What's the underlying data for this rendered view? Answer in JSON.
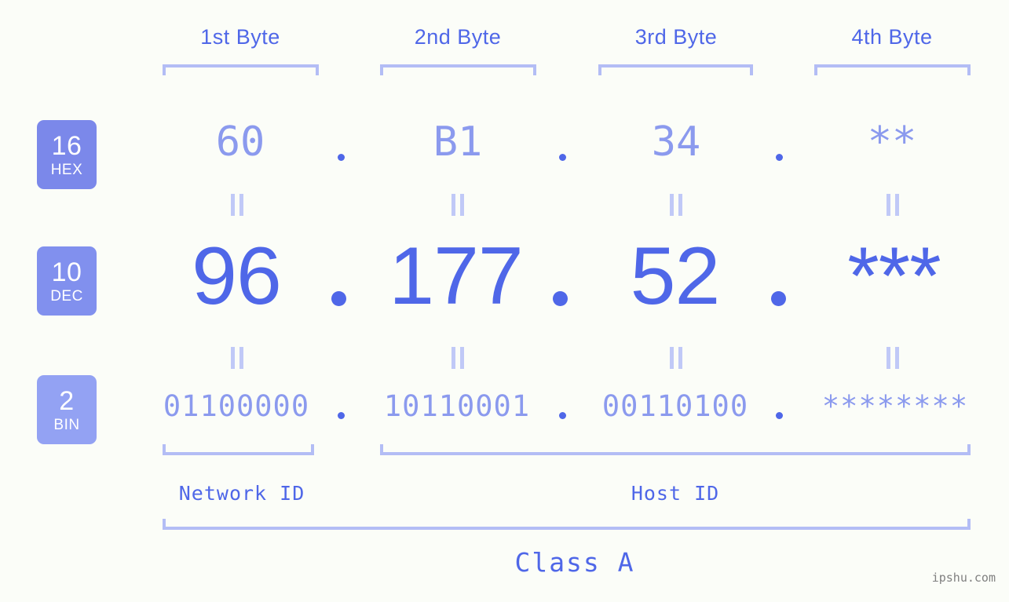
{
  "background_color": "#fbfdf8",
  "accent_color": "#4f67e8",
  "muted_accent_color": "#8b9aee",
  "bracket_color": "#b3bdf5",
  "byte_headers": [
    {
      "label": "1st Byte"
    },
    {
      "label": "2nd Byte"
    },
    {
      "label": "3rd Byte"
    },
    {
      "label": "4th Byte"
    }
  ],
  "rows": {
    "hex": {
      "badge_number": "16",
      "badge_name": "HEX",
      "badge_color": "#7b88ea",
      "values": [
        "60",
        "B1",
        "34",
        "**"
      ],
      "separator": "."
    },
    "dec": {
      "badge_number": "10",
      "badge_name": "DEC",
      "badge_color": "#8190ee",
      "values": [
        "96",
        "177",
        "52",
        "***"
      ],
      "separator": "."
    },
    "bin": {
      "badge_number": "2",
      "badge_name": "BIN",
      "badge_color": "#93a2f3",
      "values": [
        "01100000",
        "10110001",
        "00110100",
        "********"
      ],
      "separator": "."
    }
  },
  "equals_symbol": "=",
  "id_labels": {
    "network": "Network ID",
    "host": "Host ID"
  },
  "class_label": "Class A",
  "watermark": "ipshu.com"
}
